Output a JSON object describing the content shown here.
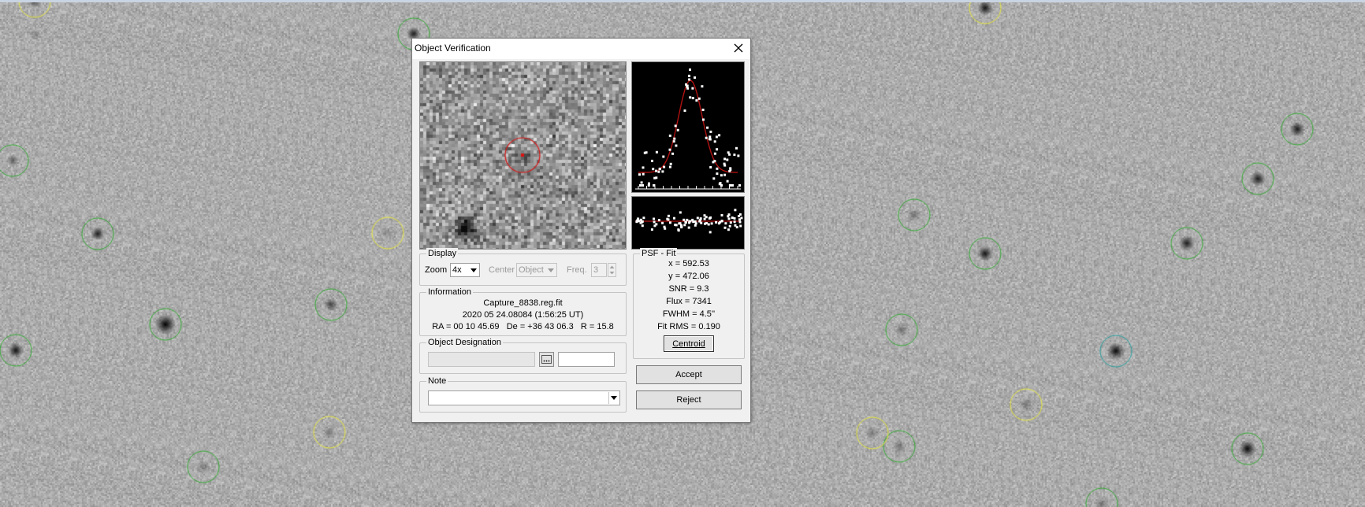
{
  "dialog": {
    "title": "Object Verification",
    "close_symbol": "✕",
    "display": {
      "legend": "Display",
      "zoom_label": "Zoom",
      "zoom_value": "4x",
      "center_label": "Center",
      "center_value": "Object",
      "freq_label": "Freq.",
      "freq_value": "3"
    },
    "information": {
      "legend": "Information",
      "filename": "Capture_8838.reg.fit",
      "date": "2020 05 24.08084 (1:56:25 UT)",
      "coords": "RA = 00 10 45.69   De = +36 43 06.3   R = 15.8"
    },
    "designation": {
      "legend": "Object Designation",
      "value": "",
      "second_value": ""
    },
    "note": {
      "legend": "Note",
      "value": ""
    },
    "psf": {
      "legend": "PSF - Fit",
      "x": "x = 592.53",
      "y": "y = 472.06",
      "snr": "SNR = 9.3",
      "flux": "Flux = 7341",
      "fwhm": "FWHM = 4.5''",
      "fit_rms": "Fit RMS = 0.190",
      "centroid_label": "Centroid"
    },
    "accept_label": "Accept",
    "reject_label": "Reject"
  },
  "colors": {
    "aperture_green": "#33aa33",
    "aperture_yellow": "#e8e840",
    "aperture_red": "#dd1111",
    "fit_curve": "#b01010"
  }
}
